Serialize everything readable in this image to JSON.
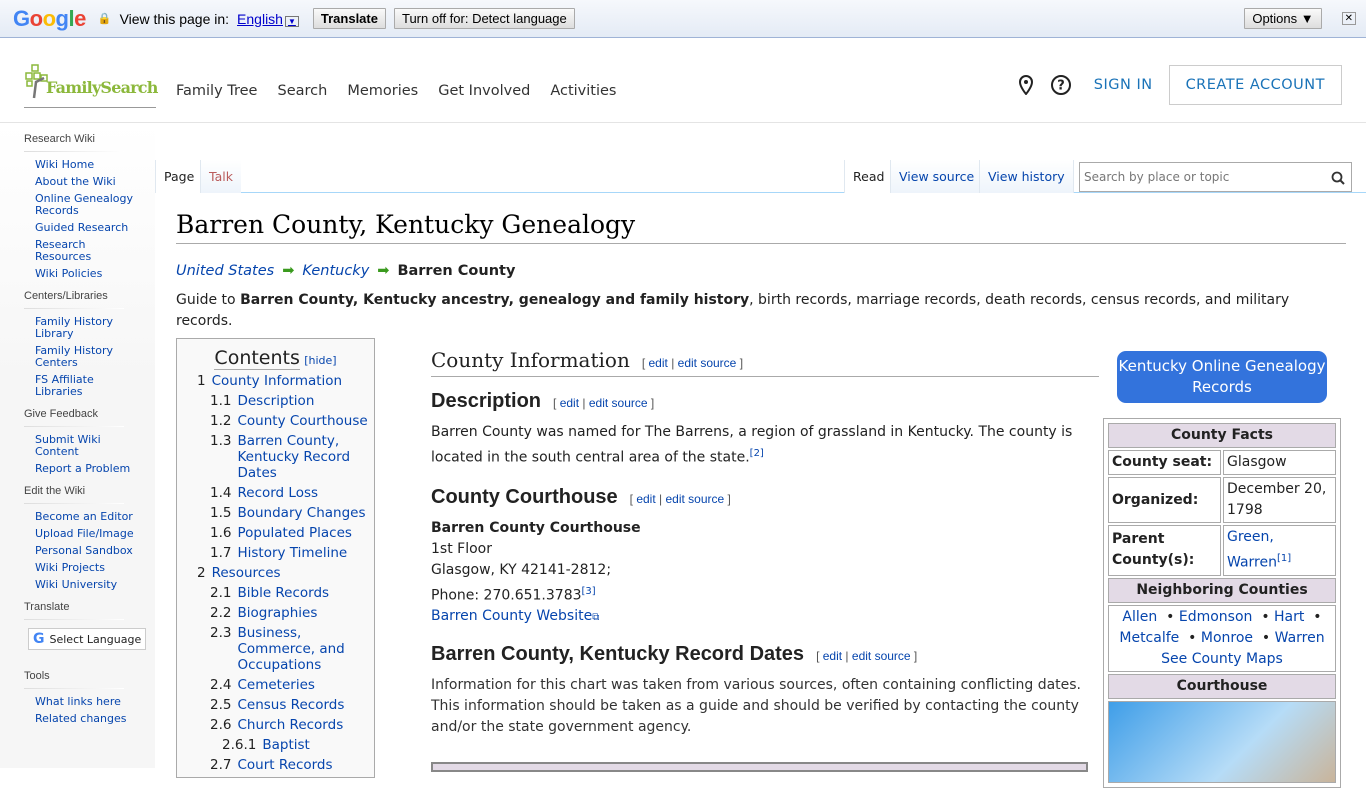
{
  "translate_bar": {
    "logo": "Google",
    "prompt": "View this page in:",
    "language": "English",
    "translate": "Translate",
    "turn_off": "Turn off for: Detect language",
    "options": "Options ▼",
    "close": "✕"
  },
  "header": {
    "logo": "FamilySearch",
    "nav": [
      "Family Tree",
      "Search",
      "Memories",
      "Get Involved",
      "Activities"
    ],
    "sign_in": "SIGN IN",
    "create_account": "CREATE ACCOUNT"
  },
  "sidebar": {
    "sections": [
      {
        "title": "Research Wiki",
        "items": [
          "Wiki Home",
          "About the Wiki",
          "Online Genealogy Records",
          "Guided Research",
          "Research Resources",
          "Wiki Policies"
        ]
      },
      {
        "title": "Centers/Libraries",
        "items": [
          "Family History Library",
          "Family History Centers",
          "FS Affiliate Libraries"
        ]
      },
      {
        "title": "Give Feedback",
        "items": [
          "Submit Wiki Content",
          "Report a Problem"
        ]
      },
      {
        "title": "Edit the Wiki",
        "items": [
          "Become an Editor",
          "Upload File/Image",
          "Personal Sandbox",
          "Wiki Projects",
          "Wiki University"
        ]
      }
    ],
    "translate_title": "Translate",
    "select_language": "Select Language",
    "tools_title": "Tools",
    "tools": [
      "What links here",
      "Related changes"
    ]
  },
  "tabs": {
    "page": "Page",
    "talk": "Talk",
    "read": "Read",
    "view_source": "View source",
    "view_history": "View history",
    "search_placeholder": "Search by place or topic"
  },
  "title": "Barren County, Kentucky Genealogy",
  "breadcrumb": [
    "United States",
    "Kentucky",
    "Barren County"
  ],
  "intro": {
    "prefix": "Guide to ",
    "bold": "Barren County, Kentucky ancestry, genealogy and family history",
    "rest": ", birth records, marriage records, death records, census records, and military records."
  },
  "toc": {
    "title": "Contents",
    "hide": "hide",
    "items": [
      {
        "n": "1",
        "t": "County Information",
        "l": 0
      },
      {
        "n": "1.1",
        "t": "Description",
        "l": 1
      },
      {
        "n": "1.2",
        "t": "County Courthouse",
        "l": 1
      },
      {
        "n": "1.3",
        "t": "Barren County, Kentucky Record Dates",
        "l": 1
      },
      {
        "n": "1.4",
        "t": "Record Loss",
        "l": 1
      },
      {
        "n": "1.5",
        "t": "Boundary Changes",
        "l": 1
      },
      {
        "n": "1.6",
        "t": "Populated Places",
        "l": 1
      },
      {
        "n": "1.7",
        "t": "History Timeline",
        "l": 1
      },
      {
        "n": "2",
        "t": "Resources",
        "l": 0
      },
      {
        "n": "2.1",
        "t": "Bible Records",
        "l": 1
      },
      {
        "n": "2.2",
        "t": "Biographies",
        "l": 1
      },
      {
        "n": "2.3",
        "t": "Business, Commerce, and Occupations",
        "l": 1
      },
      {
        "n": "2.4",
        "t": "Cemeteries",
        "l": 1
      },
      {
        "n": "2.5",
        "t": "Census Records",
        "l": 1
      },
      {
        "n": "2.6",
        "t": "Church Records",
        "l": 1
      },
      {
        "n": "2.6.1",
        "t": "Baptist",
        "l": 2
      },
      {
        "n": "2.7",
        "t": "Court Records",
        "l": 1
      }
    ]
  },
  "edit": {
    "edit": "edit",
    "edit_source": "edit source"
  },
  "main": {
    "county_info": "County Information",
    "description_h": "Description",
    "description": "Barren County was named for The Barrens, a region of grassland in Kentucky. The county is located in the south central area of the state.",
    "description_ref": "[2]",
    "courthouse_h": "County Courthouse",
    "courthouse_name": "Barren County Courthouse",
    "courthouse_lines": [
      "1st Floor",
      "Glasgow, KY 42141-2812;"
    ],
    "phone": "Phone: 270.651.3783",
    "phone_ref": "[3]",
    "website": "Barren County Website",
    "record_dates_h": "Barren County, Kentucky Record Dates",
    "record_dates_text": "Information for this chart was taken from various sources, often containing conflicting dates. This information should be taken as a guide and should be verified by contacting the county and/or the state government agency."
  },
  "ky_button": "Kentucky Online Genealogy Records",
  "infobox": {
    "title": "County Facts",
    "seat_label": "County seat:",
    "seat": "Glasgow",
    "organized_label": "Organized:",
    "organized": "December 20, 1798",
    "parent_label": "Parent County(s):",
    "parents": "Green, Warren",
    "parent_ref": "[1]",
    "neighbors_title": "Neighboring Counties",
    "neighbors": [
      "Allen",
      "Edmonson",
      "Hart",
      "Metcalfe",
      "Monroe",
      "Warren"
    ],
    "maps": "See County Maps",
    "courthouse_title": "Courthouse"
  },
  "colors": {
    "link": "#0645ad",
    "accent": "#3373dc",
    "infobox_header": "#e3dae6",
    "fs_green": "#8cb83c"
  }
}
